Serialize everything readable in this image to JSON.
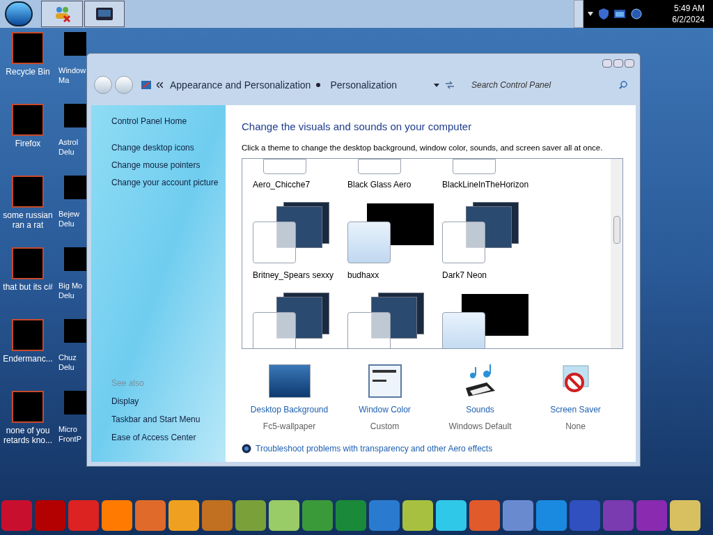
{
  "taskbar": {
    "time": "5:49 AM",
    "date": "6/2/2024"
  },
  "desktop_icons": [
    {
      "label": "Recycle Bin"
    },
    {
      "label": "Firefox"
    },
    {
      "label": "some russian ran a rat"
    },
    {
      "label": "that but its c#"
    },
    {
      "label": "Endermanc..."
    },
    {
      "label": "none of you retards kno..."
    }
  ],
  "desktop_icons_covered": [
    {
      "label": "Window Ma"
    },
    {
      "label": "Astrol Delu"
    },
    {
      "label": "Bejew Delu"
    },
    {
      "label": "Big Mo Delu"
    },
    {
      "label": "Chuz Delu"
    },
    {
      "label": "Micro FrontP"
    }
  ],
  "window": {
    "breadcrumb": [
      "Appearance and Personalization",
      "Personalization"
    ],
    "search": {
      "placeholder": "Search Control Panel"
    },
    "sidebar": {
      "links": [
        "Control Panel Home",
        "Change desktop icons",
        "Change mouse pointers",
        "Change your account picture"
      ],
      "see_also_heading": "See also",
      "see_also": [
        "Display",
        "Taskbar and Start Menu",
        "Ease of Access Center"
      ]
    },
    "heading": "Change the visuals and sounds on your computer",
    "description": "Click a theme to change the desktop background, window color, sounds, and screen saver all at once.",
    "themes": [
      {
        "name": "Aero_Chicche7",
        "kind": "partial"
      },
      {
        "name": "Black Glass Aero",
        "kind": "partial"
      },
      {
        "name": "BlackLineInTheHorizon",
        "kind": "partial"
      },
      {
        "name": "Britney_Spears sexxy",
        "kind": "stack"
      },
      {
        "name": "budhaxx",
        "kind": "single"
      },
      {
        "name": "Dark7 Neon",
        "kind": "stack"
      },
      {
        "kind": "stack"
      },
      {
        "kind": "stack"
      },
      {
        "kind": "single"
      }
    ],
    "settings": [
      {
        "kind": "background",
        "label": "Desktop Background",
        "value": "Fc5-wallpaper"
      },
      {
        "kind": "color",
        "label": "Window Color",
        "value": "Custom"
      },
      {
        "kind": "sounds",
        "label": "Sounds",
        "value": "Windows Default"
      },
      {
        "kind": "saver",
        "label": "Screen Saver",
        "value": "None"
      }
    ],
    "troubleshoot": "Troubleshoot problems with transparency and other Aero effects"
  }
}
